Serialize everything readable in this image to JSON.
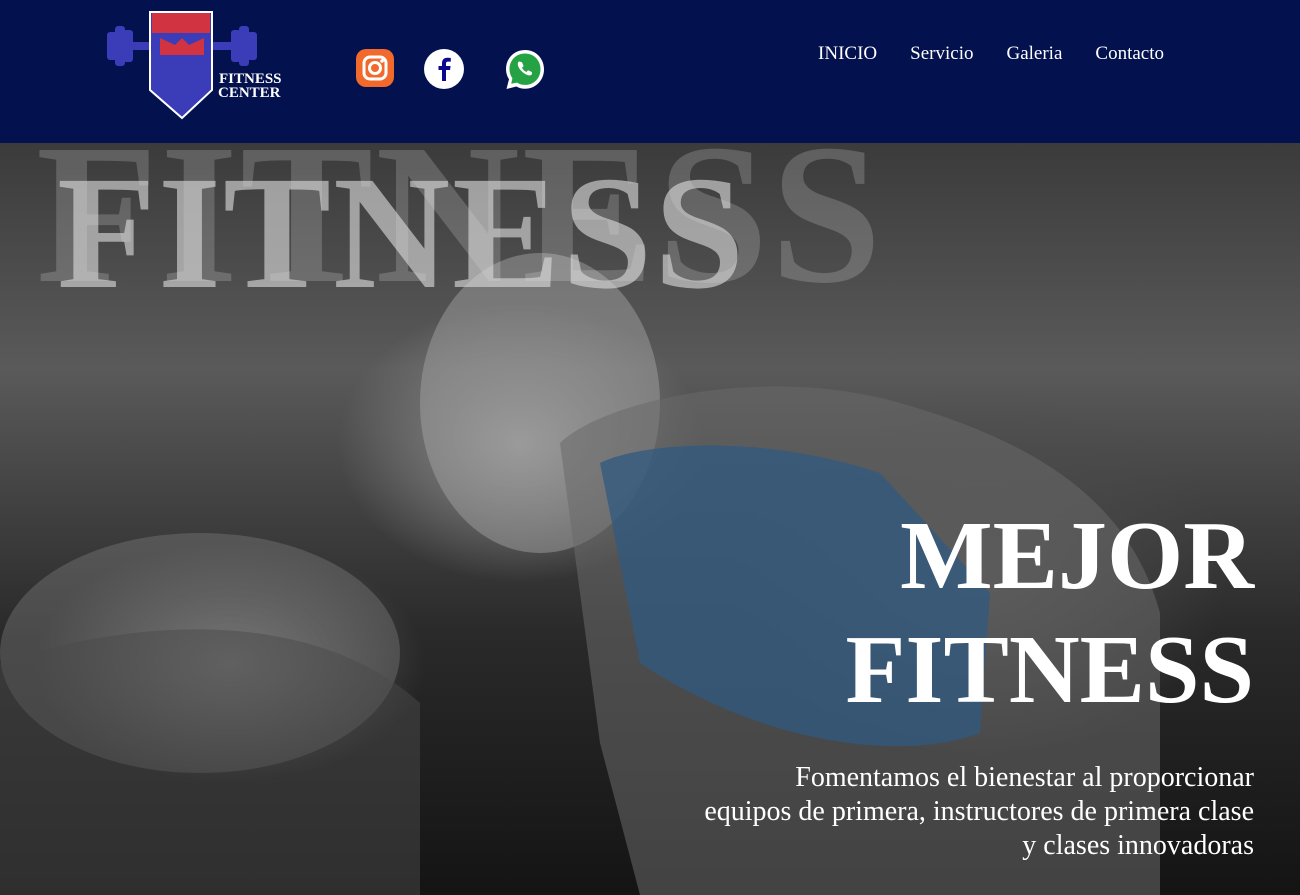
{
  "brand": {
    "line1": "FITNESS",
    "line2": "CENTER"
  },
  "social": [
    {
      "name": "instagram-icon"
    },
    {
      "name": "facebook-icon"
    },
    {
      "name": "whatsapp-icon"
    }
  ],
  "nav": [
    "INICIO",
    "Servicio",
    "Galeria",
    "Contacto"
  ],
  "hero": {
    "bg_word_back": "FITNESS",
    "bg_word_front": "FITNESS",
    "headline_line1": "MEJOR",
    "headline_line2": "FITNESS",
    "tagline_line1": "Fomentamos el bienestar al proporcionar",
    "tagline_line2": "equipos de primera, instructores de primera clase",
    "tagline_line3": "y clases innovadoras"
  },
  "colors": {
    "header_bg": "#03114e",
    "logo_blue": "#3a3cb8",
    "logo_red": "#d23340",
    "instagram": "#f16a2b",
    "whatsapp": "#25a244",
    "facebook": "#0a0a8c"
  }
}
